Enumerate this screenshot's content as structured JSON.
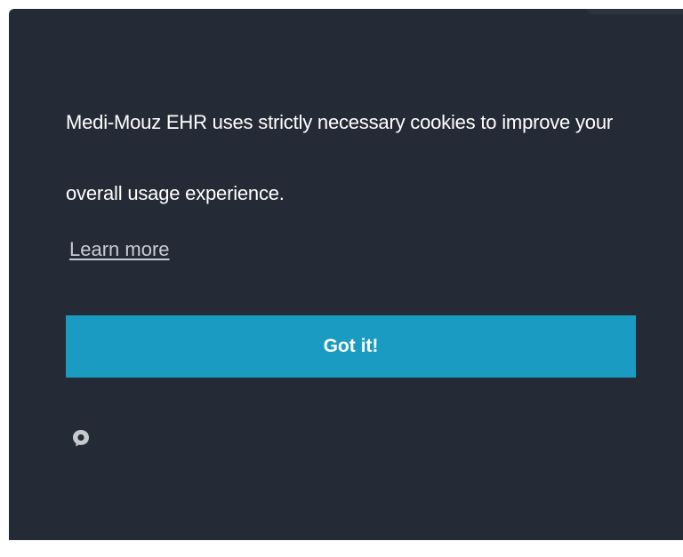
{
  "cookie_notice": {
    "message": "Medi-Mouz EHR uses strictly necessary cookies to improve your overall usage experience.",
    "learn_more_label": "Learn more",
    "accept_button_label": "Got it!",
    "brand_icon": "speech-bubble-icon"
  },
  "colors": {
    "banner_background": "#252b36",
    "button_background": "#1a9cc2",
    "text": "#ffffff",
    "link": "#c6cbd3"
  }
}
